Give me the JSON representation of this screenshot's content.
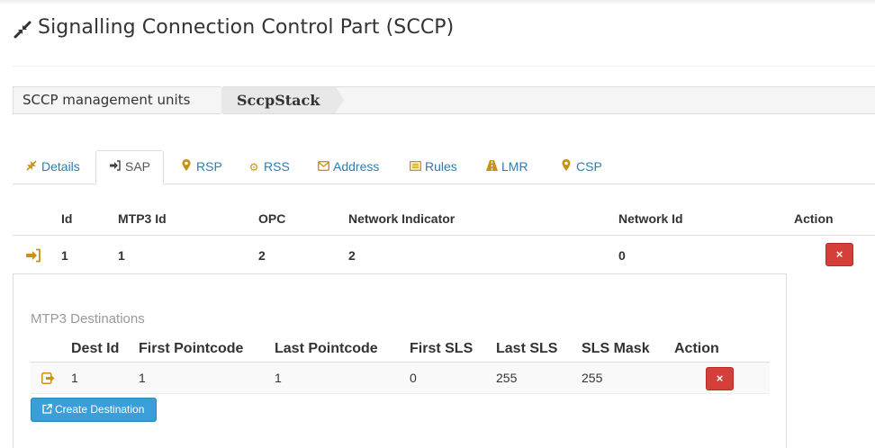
{
  "header": {
    "title": "Signalling Connection Control Part (SCCP)",
    "icon": "compress-icon"
  },
  "breadcrumb": {
    "items": [
      "SCCP management units",
      "SccpStack"
    ]
  },
  "tabs": [
    {
      "label": "Details",
      "icon": "compress-icon",
      "active": false
    },
    {
      "label": "SAP",
      "icon": "sign-in-icon",
      "active": true
    },
    {
      "label": "RSP",
      "icon": "map-marker-icon",
      "active": false
    },
    {
      "label": "RSS",
      "icon": "gear-icon",
      "active": false
    },
    {
      "label": "Address",
      "icon": "envelope-icon",
      "active": false
    },
    {
      "label": "Rules",
      "icon": "list-icon",
      "active": false
    },
    {
      "label": "LMR",
      "icon": "road-icon",
      "active": false
    },
    {
      "label": "CSP",
      "icon": "map-marker-icon",
      "active": false
    }
  ],
  "sap_table": {
    "columns": [
      "Id",
      "MTP3 Id",
      "OPC",
      "Network Indicator",
      "Network Id",
      "Action"
    ],
    "rows": [
      {
        "id": "1",
        "mtp3_id": "1",
        "opc": "2",
        "network_indicator": "2",
        "network_id": "0",
        "action": "×"
      }
    ]
  },
  "destinations": {
    "title": "MTP3 Destinations",
    "columns": [
      "Dest Id",
      "First Pointcode",
      "Last Pointcode",
      "First SLS",
      "Last SLS",
      "SLS Mask",
      "Action"
    ],
    "rows": [
      {
        "dest_id": "1",
        "first_pointcode": "1",
        "last_pointcode": "1",
        "first_sls": "0",
        "last_sls": "255",
        "sls_mask": "255",
        "action": "×"
      }
    ],
    "create_button": "Create Destination"
  },
  "colors": {
    "link": "#2a7fb0",
    "icon_accent": "#c79216",
    "danger": "#d43f3a",
    "primary": "#3a9fd8"
  }
}
